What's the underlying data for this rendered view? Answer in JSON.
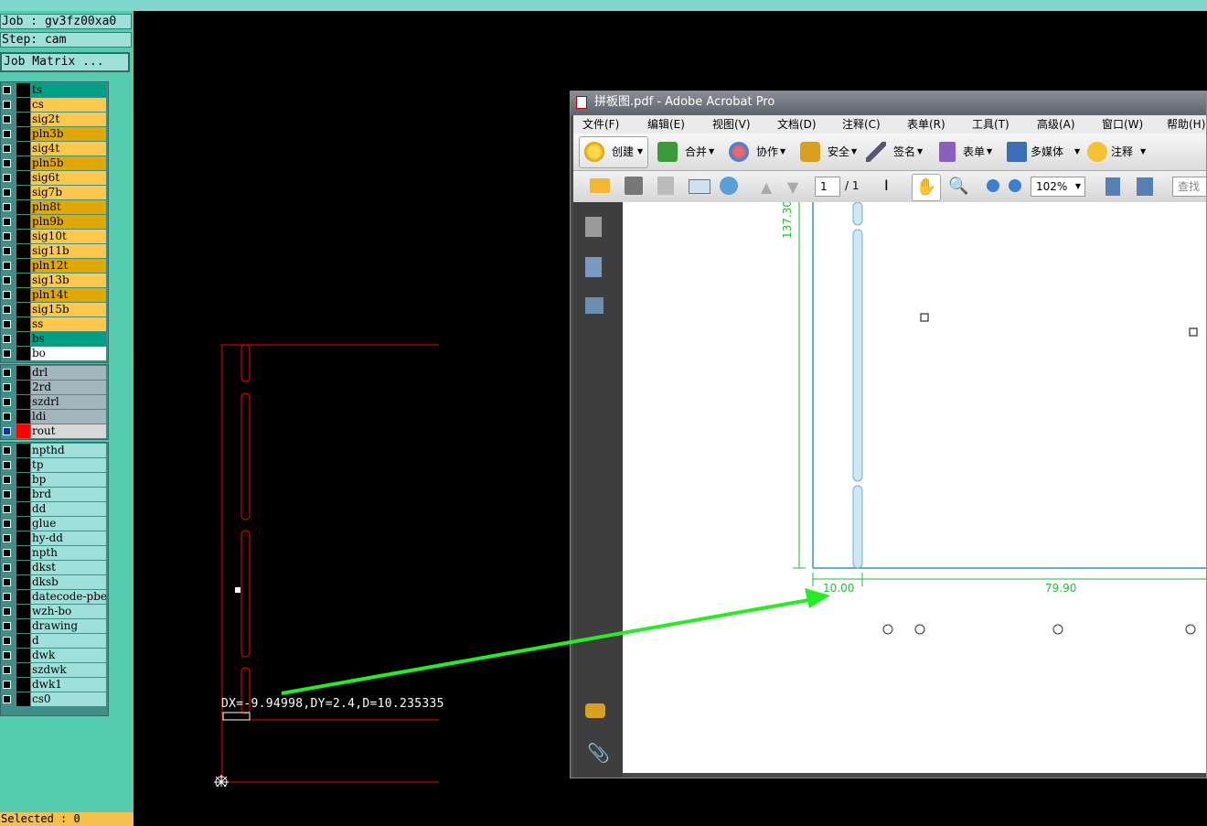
{
  "left_panel": {
    "job": "Job : gv3fz00xa0",
    "step": "Step: cam",
    "job_matrix_button": "Job Matrix ...",
    "selected": "Selected : 0",
    "layers": [
      {
        "name": "ts",
        "color": "#00a085"
      },
      {
        "name": "cs",
        "color": "#ffc84a"
      },
      {
        "name": "sig2t",
        "color": "#ffc84a"
      },
      {
        "name": "pln3b",
        "color": "#e0a800"
      },
      {
        "name": "sig4t",
        "color": "#ffc84a"
      },
      {
        "name": "pln5b",
        "color": "#e0a800"
      },
      {
        "name": "sig6t",
        "color": "#ffc84a"
      },
      {
        "name": "sig7b",
        "color": "#ffc84a"
      },
      {
        "name": "pln8t",
        "color": "#e0a800"
      },
      {
        "name": "pln9b",
        "color": "#e0a800"
      },
      {
        "name": "sig10t",
        "color": "#ffc84a"
      },
      {
        "name": "sig11b",
        "color": "#ffc84a"
      },
      {
        "name": "pln12t",
        "color": "#e0a800"
      },
      {
        "name": "sig13b",
        "color": "#ffc84a"
      },
      {
        "name": "pln14t",
        "color": "#e0a800"
      },
      {
        "name": "sig15b",
        "color": "#ffc84a"
      },
      {
        "name": "ss",
        "color": "#ffc84a"
      },
      {
        "name": "bs",
        "color": "#00a085"
      },
      {
        "name": "bo",
        "color": "#ffffff"
      }
    ],
    "drill_layers": [
      {
        "name": "drl",
        "color": "#a3b5bd"
      },
      {
        "name": "2rd",
        "color": "#a3b5bd"
      },
      {
        "name": "szdrl",
        "color": "#a3b5bd"
      },
      {
        "name": "ldi",
        "color": "#a3b5bd"
      },
      {
        "name": "rout",
        "color": "#d8d8d8"
      }
    ],
    "misc_layers": [
      "npthd",
      "tp",
      "bp",
      "brd",
      "dd",
      "glue",
      "hy-dd",
      "npth",
      "dkst",
      "dksb",
      "datecode-pbe",
      "wzh-bo",
      "drawing",
      "d",
      "dwk",
      "szdwk",
      "dwk1",
      "cs0"
    ]
  },
  "cad": {
    "measure_text": "DX=-9.94998,DY=2.4,D=10.235335",
    "outline_color": "#ff0000",
    "arrow_color": "#22ee22"
  },
  "acrobat": {
    "title": "拼板图.pdf - Adobe Acrobat Pro",
    "menu": [
      "文件(F)",
      "编辑(E)",
      "视图(V)",
      "文档(D)",
      "注释(C)",
      "表单(R)",
      "工具(T)",
      "高级(A)",
      "窗口(W)",
      "帮助(H)"
    ],
    "toolbar": {
      "create": "创建",
      "combine": "合并",
      "collaborate": "协作",
      "secure": "安全",
      "sign": "签名",
      "forms": "表单",
      "multimedia": "多媒体",
      "comment": "注释"
    },
    "page_current": "1",
    "page_total": "/ 1",
    "zoom": "102%",
    "search_placeholder": "查找",
    "dimensions": {
      "vertical": "137.30",
      "left": "10.00",
      "right": "79.90"
    },
    "dimension_color": "#22bb33"
  }
}
